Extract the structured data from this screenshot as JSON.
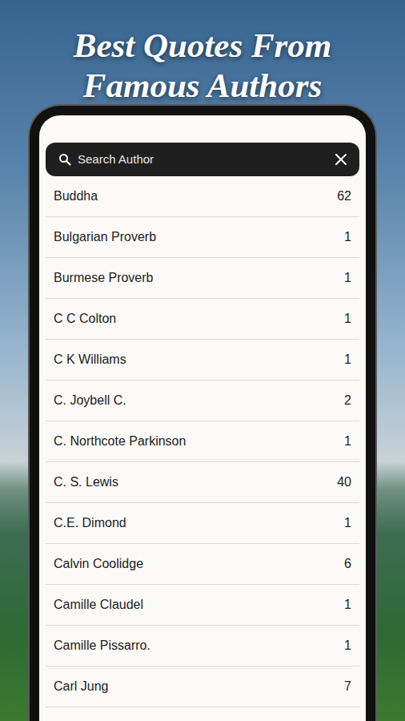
{
  "heading": [
    "Best Quotes From",
    "Famous Authors"
  ],
  "search": {
    "placeholder": "Search Author"
  },
  "authors": [
    {
      "name": "Buddha",
      "count": "62"
    },
    {
      "name": "Bulgarian Proverb",
      "count": "1"
    },
    {
      "name": "Burmese Proverb",
      "count": "1"
    },
    {
      "name": "C C Colton",
      "count": "1"
    },
    {
      "name": "C K Williams",
      "count": "1"
    },
    {
      "name": "C. Joybell C.",
      "count": "2"
    },
    {
      "name": "C. Northcote Parkinson",
      "count": "1"
    },
    {
      "name": "C. S. Lewis",
      "count": "40"
    },
    {
      "name": "C.E. Dimond",
      "count": "1"
    },
    {
      "name": "Calvin Coolidge",
      "count": "6"
    },
    {
      "name": "Camille Claudel",
      "count": "1"
    },
    {
      "name": "Camille Pissarro.",
      "count": "1"
    },
    {
      "name": "Carl Jung",
      "count": "7"
    }
  ]
}
